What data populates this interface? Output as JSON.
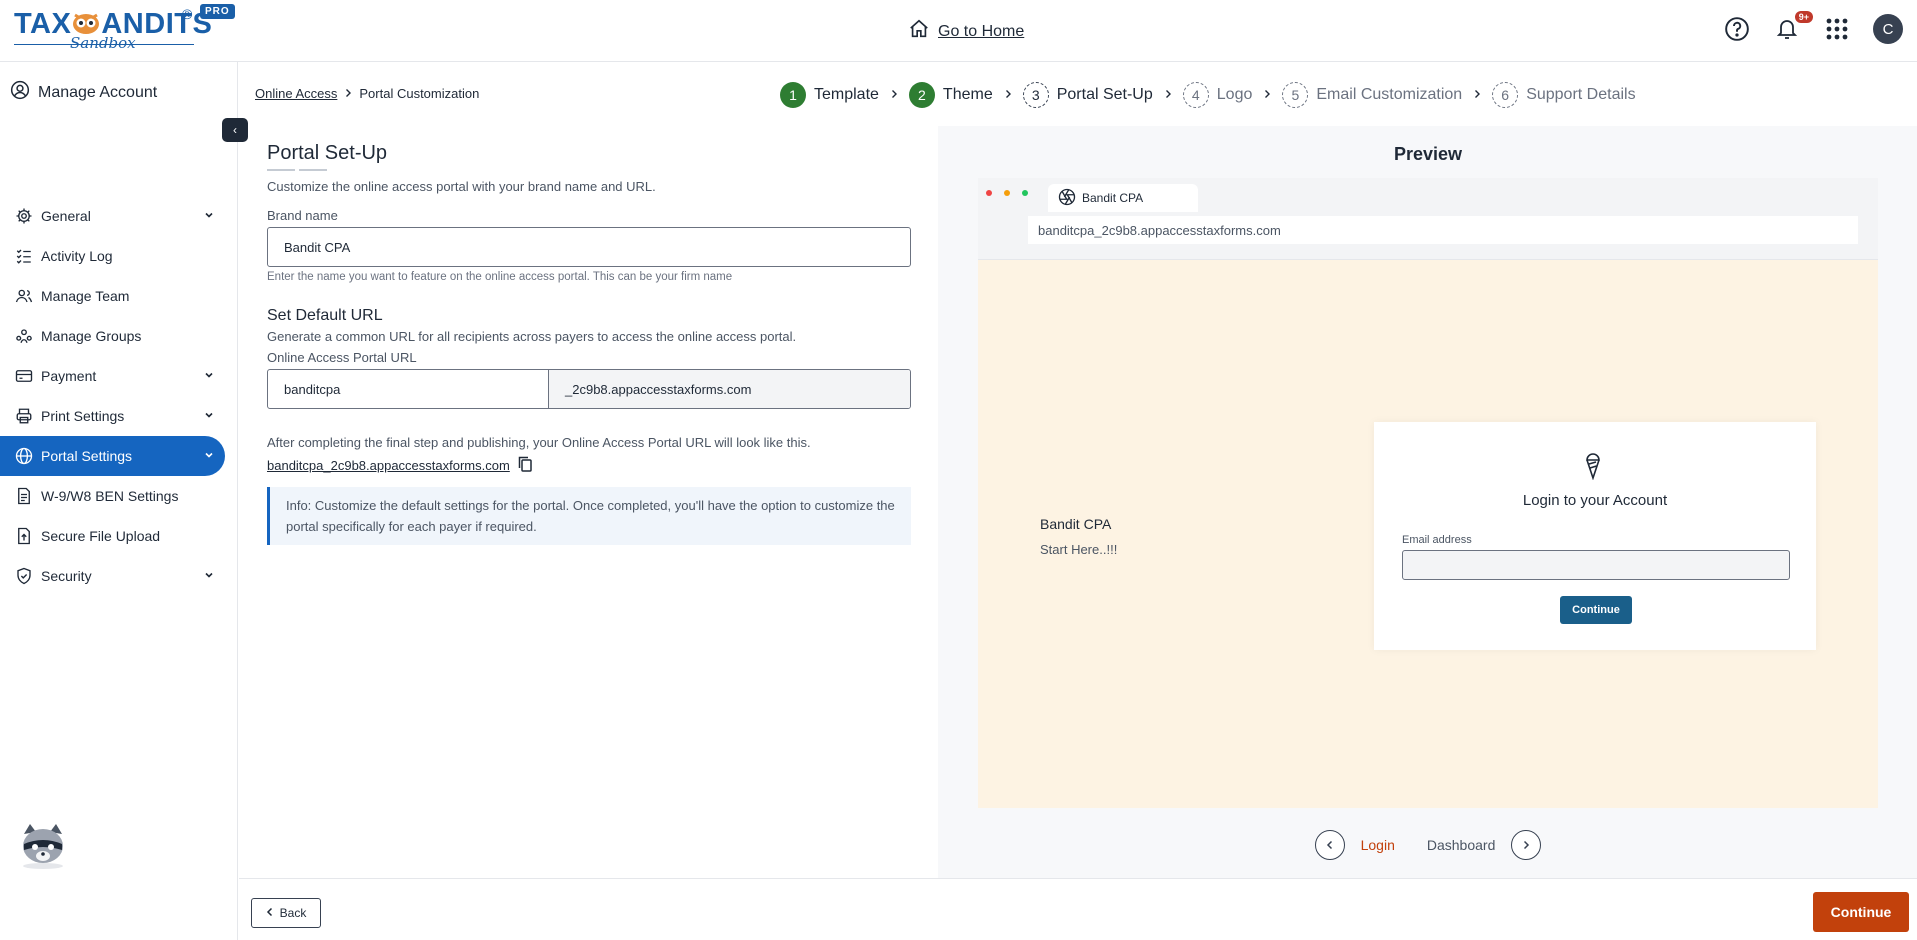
{
  "header": {
    "logo_text_left": "TAX",
    "logo_text_right": "ANDITS",
    "logo_reg": "®",
    "logo_badge": "PRO",
    "logo_sub": "Sandbox",
    "home_link": "Go to Home",
    "notification_count": "9+",
    "avatar_initial": "C"
  },
  "sidebar": {
    "manage_account": "Manage Account",
    "items": [
      {
        "label": "General",
        "icon": "gear-icon",
        "expandable": true
      },
      {
        "label": "Activity Log",
        "icon": "list-check-icon",
        "expandable": false
      },
      {
        "label": "Manage Team",
        "icon": "users-icon",
        "expandable": false
      },
      {
        "label": "Manage Groups",
        "icon": "groups-icon",
        "expandable": false
      },
      {
        "label": "Payment",
        "icon": "card-icon",
        "expandable": true
      },
      {
        "label": "Print Settings",
        "icon": "printer-icon",
        "expandable": true
      },
      {
        "label": "Portal Settings",
        "icon": "globe-icon",
        "expandable": true,
        "active": true
      },
      {
        "label": "W-9/W8 BEN Settings",
        "icon": "document-icon",
        "expandable": false
      },
      {
        "label": "Secure File Upload",
        "icon": "upload-icon",
        "expandable": false
      },
      {
        "label": "Security",
        "icon": "shield-icon",
        "expandable": true
      }
    ]
  },
  "breadcrumb": {
    "parent": "Online Access",
    "current": "Portal Customization"
  },
  "stepper": [
    {
      "num": "1",
      "label": "Template",
      "state": "done"
    },
    {
      "num": "2",
      "label": "Theme",
      "state": "done"
    },
    {
      "num": "3",
      "label": "Portal Set-Up",
      "state": "cur"
    },
    {
      "num": "4",
      "label": "Logo",
      "state": "todo"
    },
    {
      "num": "5",
      "label": "Email Customization",
      "state": "todo"
    },
    {
      "num": "6",
      "label": "Support Details",
      "state": "todo"
    }
  ],
  "form": {
    "title": "Portal Set-Up",
    "description": "Customize the online access portal with your brand name and URL.",
    "brand_label": "Brand name",
    "brand_value": "Bandit CPA",
    "brand_hint": "Enter the name you want to feature on the online access portal. This can be your firm name",
    "url_section_title": "Set Default URL",
    "url_section_desc": "Generate a common URL for all recipients across payers to access the online access portal.",
    "url_label": "Online Access Portal URL",
    "url_prefix_value": "banditcpa",
    "url_suffix": "_2c9b8.appaccesstaxforms.com",
    "after_text": "After completing the final step and publishing, your Online Access Portal URL will look like this.",
    "final_url": "banditcpa_2c9b8.appaccesstaxforms.com",
    "info_prefix": "Info:",
    "info_text": " Customize the default settings for the portal. Once completed, you'll have the option to customize the portal specifically for each payer if required."
  },
  "preview": {
    "title": "Preview",
    "tab_title": "Bandit CPA",
    "address": "banditcpa_2c9b8.appaccesstaxforms.com",
    "brand": "Bandit CPA",
    "tagline": "Start Here..!!!",
    "login_title": "Login to your Account",
    "email_label": "Email address",
    "continue_label": "Continue",
    "pager_tabs": [
      "Login",
      "Dashboard"
    ],
    "active_tab": "Login"
  },
  "footer": {
    "back_label": "Back",
    "continue_label": "Continue"
  },
  "colors": {
    "primary_blue": "#1565c0",
    "done_green": "#2e7d32",
    "accent_orange": "#c2410c",
    "preview_bg": "#fdf3e3"
  }
}
